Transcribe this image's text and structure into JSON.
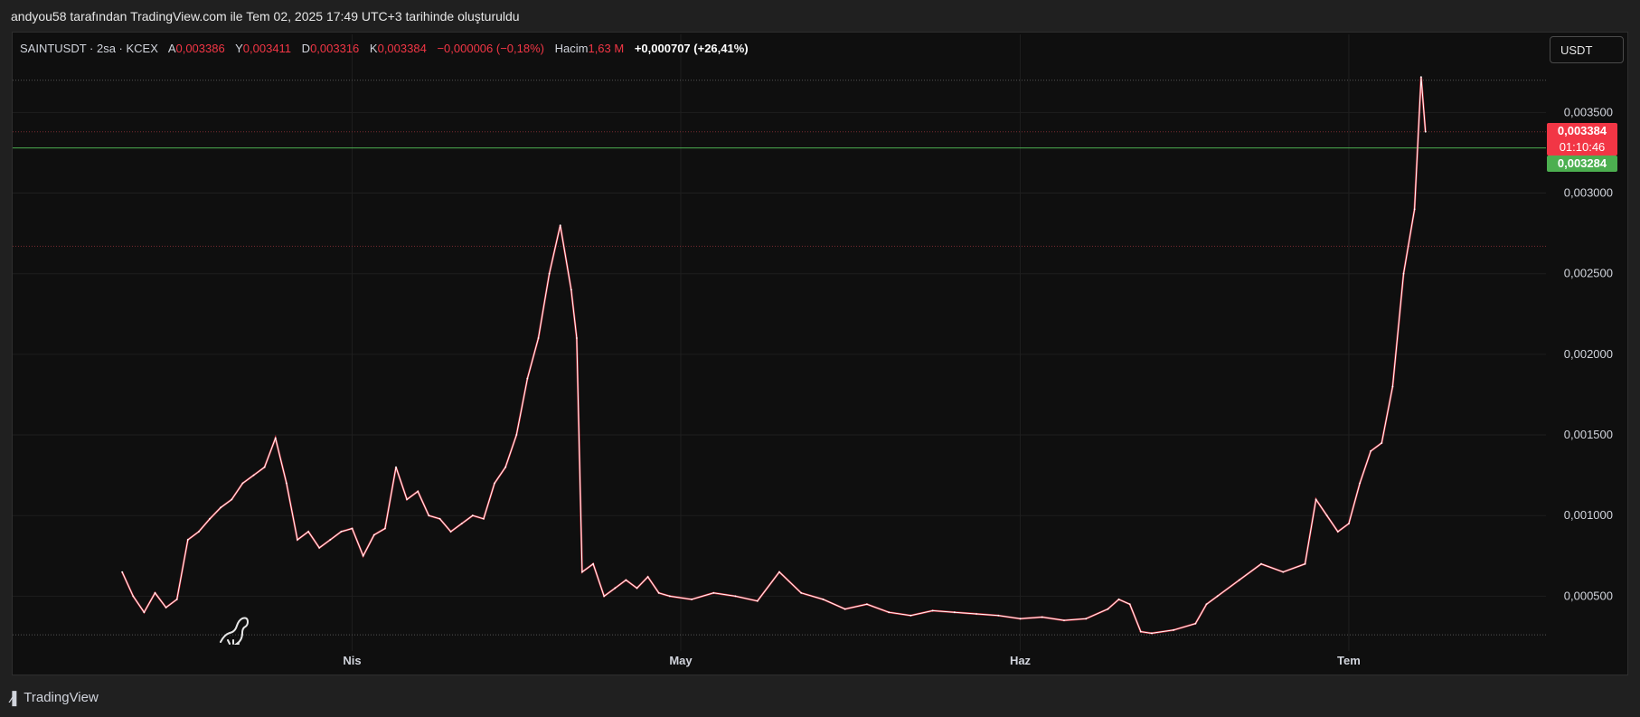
{
  "caption": "andyou58 tarafından TradingView.com ile Tem 02, 2025 17:49 UTC+3 tarihinde oluşturuldu",
  "legend": {
    "symbol": "SAINTUSDT · 2sa · KCEX",
    "open_label": "A",
    "open": "0,003386",
    "high_label": "Y",
    "high": "0,003411",
    "low_label": "D",
    "low": "0,003316",
    "close_label": "K",
    "close": "0,003384",
    "change": "−0,000006 (−0,18%)",
    "volume_label": "Hacim",
    "volume": "1,63 M",
    "total_change": "+0,000707 (+26,41%)"
  },
  "currency_button": "USDT",
  "footer_brand": "TradingView",
  "colors": {
    "line": "#ffffff",
    "down": "#f23645",
    "green_line": "#4caf50",
    "grid": "#1f1f1f",
    "dotted_red": "#7a2b30"
  },
  "chart_data": {
    "type": "line",
    "y_ticks": [
      0.0005,
      0.001,
      0.0015,
      0.002,
      0.0025,
      0.003,
      0.0035
    ],
    "y_tick_labels": [
      "0,000500",
      "0,001000",
      "0,001500",
      "0,002000",
      "0,002500",
      "0,003000",
      "0,003500"
    ],
    "ylim": [
      0.00016,
      0.00376
    ],
    "x_ticks": [
      {
        "label": "Nis",
        "day": 31
      },
      {
        "label": "May",
        "day": 61
      },
      {
        "label": "Haz",
        "day": 92
      },
      {
        "label": "Tem",
        "day": 122
      }
    ],
    "xlim": [
      0,
      140
    ],
    "grid": true,
    "series": [
      {
        "points": [
          [
            10,
            0.00065
          ],
          [
            11,
            0.0005
          ],
          [
            12,
            0.0004
          ],
          [
            13,
            0.00052
          ],
          [
            14,
            0.00043
          ],
          [
            15,
            0.00048
          ],
          [
            16,
            0.00085
          ],
          [
            17,
            0.0009
          ],
          [
            18,
            0.00098
          ],
          [
            19,
            0.00105
          ],
          [
            20,
            0.0011
          ],
          [
            21,
            0.0012
          ],
          [
            22,
            0.00125
          ],
          [
            23,
            0.0013
          ],
          [
            24,
            0.00148
          ],
          [
            25,
            0.0012
          ],
          [
            26,
            0.00085
          ],
          [
            27,
            0.0009
          ],
          [
            28,
            0.0008
          ],
          [
            29,
            0.00085
          ],
          [
            30,
            0.0009
          ],
          [
            31,
            0.00092
          ],
          [
            32,
            0.00075
          ],
          [
            33,
            0.00088
          ],
          [
            34,
            0.00092
          ],
          [
            35,
            0.0013
          ],
          [
            36,
            0.0011
          ],
          [
            37,
            0.00115
          ],
          [
            38,
            0.001
          ],
          [
            39,
            0.00098
          ],
          [
            40,
            0.0009
          ],
          [
            41,
            0.00095
          ],
          [
            42,
            0.001
          ],
          [
            43,
            0.00098
          ],
          [
            44,
            0.0012
          ],
          [
            45,
            0.0013
          ],
          [
            46,
            0.0015
          ],
          [
            47,
            0.00185
          ],
          [
            48,
            0.0021
          ],
          [
            49,
            0.0025
          ],
          [
            50,
            0.0028
          ],
          [
            51,
            0.0024
          ],
          [
            51.5,
            0.0021
          ],
          [
            52,
            0.00065
          ],
          [
            53,
            0.0007
          ],
          [
            54,
            0.0005
          ],
          [
            55,
            0.00055
          ],
          [
            56,
            0.0006
          ],
          [
            57,
            0.00055
          ],
          [
            58,
            0.00062
          ],
          [
            59,
            0.00052
          ],
          [
            60,
            0.0005
          ],
          [
            62,
            0.00048
          ],
          [
            64,
            0.00052
          ],
          [
            66,
            0.0005
          ],
          [
            68,
            0.00047
          ],
          [
            70,
            0.00065
          ],
          [
            72,
            0.00052
          ],
          [
            74,
            0.00048
          ],
          [
            76,
            0.00042
          ],
          [
            78,
            0.00045
          ],
          [
            80,
            0.0004
          ],
          [
            82,
            0.00038
          ],
          [
            84,
            0.00041
          ],
          [
            86,
            0.0004
          ],
          [
            88,
            0.00039
          ],
          [
            90,
            0.00038
          ],
          [
            92,
            0.00036
          ],
          [
            94,
            0.00037
          ],
          [
            96,
            0.00035
          ],
          [
            98,
            0.00036
          ],
          [
            100,
            0.00042
          ],
          [
            101,
            0.00048
          ],
          [
            102,
            0.00045
          ],
          [
            103,
            0.00028
          ],
          [
            104,
            0.00027
          ],
          [
            106,
            0.00029
          ],
          [
            108,
            0.00033
          ],
          [
            109,
            0.00045
          ],
          [
            110,
            0.0005
          ],
          [
            112,
            0.0006
          ],
          [
            114,
            0.0007
          ],
          [
            116,
            0.00065
          ],
          [
            118,
            0.0007
          ],
          [
            119,
            0.0011
          ],
          [
            120,
            0.001
          ],
          [
            121,
            0.0009
          ],
          [
            122,
            0.00095
          ],
          [
            123,
            0.0012
          ],
          [
            124,
            0.0014
          ],
          [
            125,
            0.00145
          ],
          [
            126,
            0.0018
          ],
          [
            127,
            0.0025
          ],
          [
            128,
            0.0029
          ],
          [
            128.6,
            0.00372
          ],
          [
            129,
            0.00338
          ]
        ]
      }
    ],
    "horizontal_lines": [
      {
        "price": 0.0037,
        "style": "dotted",
        "color": "#555555"
      },
      {
        "price": 0.00338,
        "style": "dotted",
        "color": "#7a2b30"
      },
      {
        "price": 0.00328,
        "style": "solid",
        "color": "#4caf50"
      },
      {
        "price": 0.00267,
        "style": "dotted",
        "color": "#7a2b30"
      },
      {
        "price": 0.00026,
        "style": "dotted",
        "color": "#555555"
      }
    ],
    "price_labels": [
      {
        "price": 0.003384,
        "text": "0,003384",
        "sub": "01:10:46",
        "color": "#f23645"
      },
      {
        "price": 0.003284,
        "text": "0,003284",
        "color": "#4caf50"
      }
    ]
  }
}
